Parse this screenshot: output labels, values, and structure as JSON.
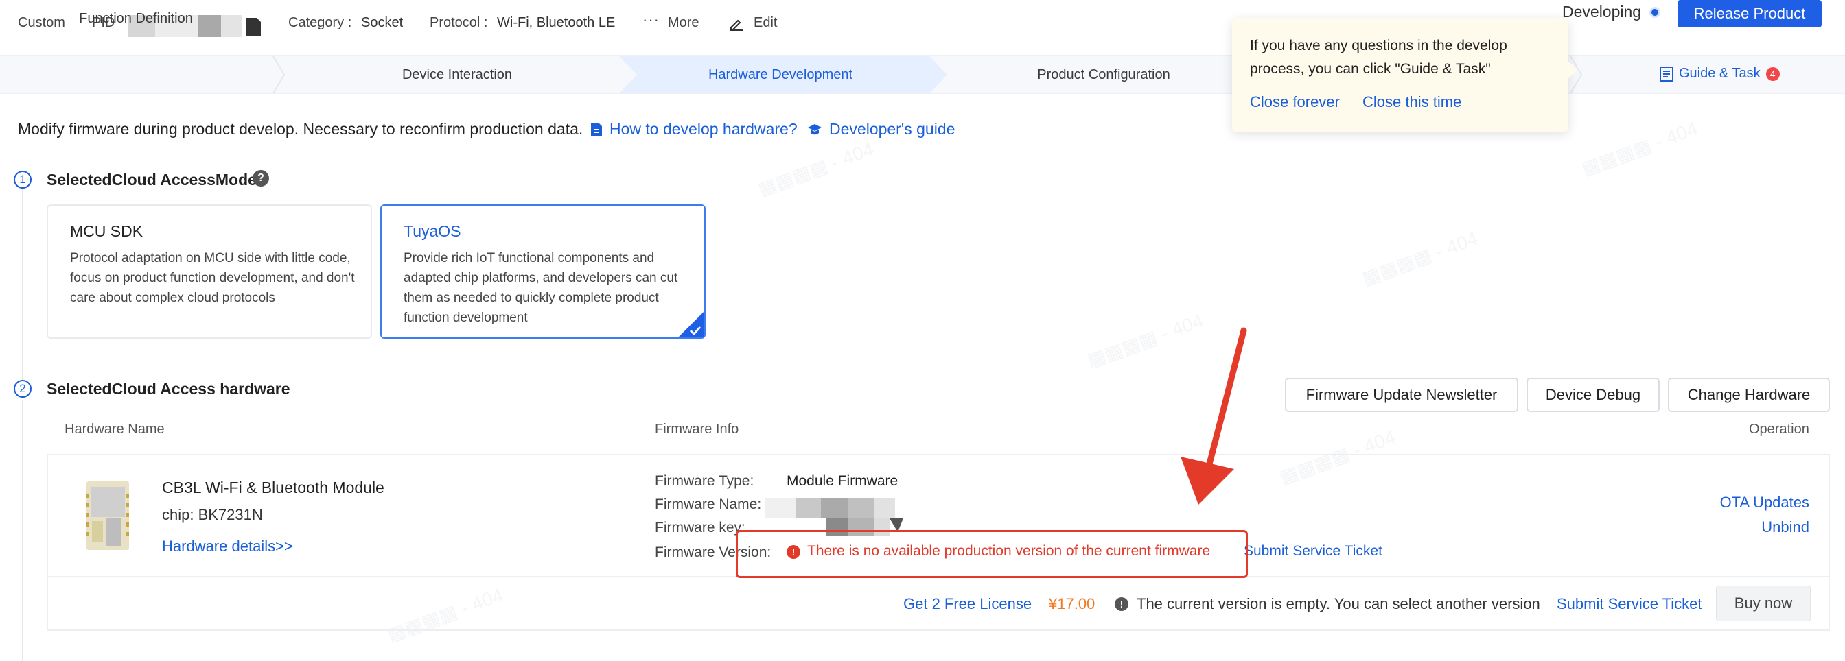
{
  "topbar": {
    "custom": "Custom",
    "pid_label": "PID",
    "category_label": "Category :",
    "category_value": "Socket",
    "protocol_label": "Protocol :",
    "protocol_value": "Wi-Fi, Bluetooth LE",
    "more": "More",
    "edit": "Edit",
    "status": "Developing",
    "release": "Release Product"
  },
  "steps": [
    {
      "label": "Function Definition"
    },
    {
      "label": "Device Interaction"
    },
    {
      "label": "Hardware Development",
      "active": true
    },
    {
      "label": "Product Configuration"
    }
  ],
  "guide": {
    "label": "Guide & Task",
    "badge": "4"
  },
  "tooltip": {
    "text": "If you have any questions in the develop process, you can click \"Guide & Task\"",
    "close_forever": "Close forever",
    "close_time": "Close this time"
  },
  "intro": {
    "text": "Modify firmware during product develop. Necessary to reconfirm production data.",
    "link_how": "How to develop hardware?",
    "link_guide": "Developer's guide"
  },
  "section1": {
    "num": "1",
    "title": "SelectedCloud AccessMode",
    "help": "?",
    "cards": [
      {
        "title": "MCU SDK",
        "desc": "Protocol adaptation on MCU side with little code, focus on product function development, and don't care about complex cloud protocols",
        "selected": false
      },
      {
        "title": "TuyaOS",
        "desc": "Provide rich IoT functional components and adapted chip platforms, and developers can cut them as needed to quickly complete product function development",
        "selected": true
      }
    ]
  },
  "section2": {
    "num": "2",
    "title": "SelectedCloud Access hardware",
    "buttons": {
      "newsletter": "Firmware Update Newsletter",
      "debug": "Device Debug",
      "change": "Change Hardware"
    },
    "columns": {
      "name": "Hardware Name",
      "firmware": "Firmware Info",
      "operation": "Operation"
    },
    "hardware": {
      "name": "CB3L Wi-Fi & Bluetooth Module",
      "chip": "chip: BK7231N",
      "details": "Hardware details>>"
    },
    "firmware": {
      "type_label": "Firmware Type:",
      "type_value": "Module Firmware",
      "name_label": "Firmware Name:",
      "key_label": "Firmware key:",
      "version_label": "Firmware Version:",
      "error": "There is no available production version of the current firmware",
      "submit": "Submit Service Ticket"
    },
    "operations": {
      "ota": "OTA Updates",
      "unbind": "Unbind"
    },
    "footer": {
      "license": "Get 2 Free License",
      "price": "¥17.00",
      "note": "The current version is empty. You can select another version",
      "submit": "Submit Service Ticket",
      "buy": "Buy now"
    }
  },
  "colors": {
    "accent": "#1f5fe6",
    "error": "#e23a2a",
    "tooltip_bg": "#fefaec"
  }
}
